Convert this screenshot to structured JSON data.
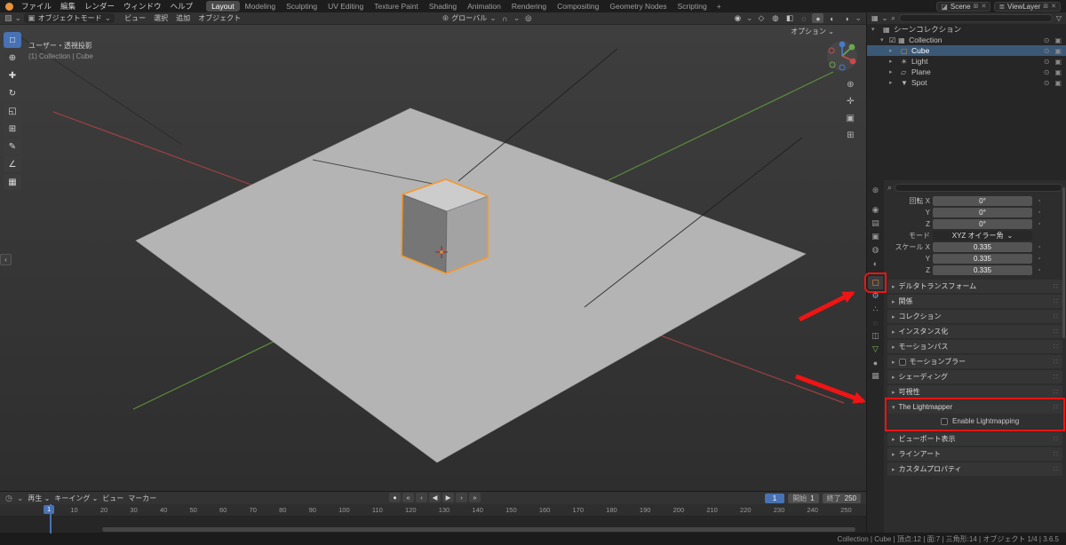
{
  "colors": {
    "accent_blue": "#4772b3",
    "selection_orange": "#e8923d",
    "annotation_red": "#f01414"
  },
  "icons": {
    "chevron_down": "⌄",
    "chevron_right": "▸",
    "chevron_open": "▾",
    "eye": "⊙",
    "camera_toggle": "▣",
    "search": "⌕",
    "drag_dots": "∷",
    "lock": "▫",
    "magnet": "∩",
    "proportional": "◎",
    "orientation_globe": "⊕",
    "shading_wire": "◌",
    "shading_solid": "●",
    "shading_material": "◐",
    "shading_rendered": "◑",
    "grid": "⊞",
    "pan": "✛",
    "zoom": "⊕",
    "view_camera": "▣",
    "plus": "+",
    "close": "✕",
    "funnel": "▽",
    "collection": "▦",
    "editor_viewport": "▧",
    "editor_timeline": "◷",
    "menu": "≡",
    "auto_key": "●",
    "object_mode": "▣",
    "overlays": "◍",
    "xray": "◧",
    "gizmo": "◇",
    "visibility": "◉",
    "scene": "◪",
    "viewlayer": "≣",
    "new": "⊞",
    "sidebar_arrow": "‹"
  },
  "topbar": {
    "menus": [
      "ファイル",
      "編集",
      "レンダー",
      "ウィンドウ",
      "ヘルプ"
    ],
    "workspaces": [
      {
        "label": "Layout",
        "cls": "active"
      },
      {
        "label": "Modeling"
      },
      {
        "label": "Sculpting"
      },
      {
        "label": "UV Editing"
      },
      {
        "label": "Texture Paint"
      },
      {
        "label": "Shading"
      },
      {
        "label": "Animation"
      },
      {
        "label": "Rendering"
      },
      {
        "label": "Compositing"
      },
      {
        "label": "Geometry Nodes"
      },
      {
        "label": "Scripting"
      }
    ],
    "add_workspace": "+",
    "scene_label": "Scene",
    "viewlayer_label": "ViewLayer"
  },
  "viewport": {
    "header": {
      "mode": "オブジェクトモード",
      "menus": [
        "ビュー",
        "選択",
        "追加",
        "オブジェクト"
      ],
      "orientation": "グローバル"
    },
    "options_label": "オプション",
    "overlay_line1": "ユーザー・透視投影",
    "overlay_line2": "(1) Collection | Cube",
    "tools": [
      {
        "name": "tool-select-box",
        "glyph": "□",
        "cls": "active"
      },
      {
        "name": "tool-cursor",
        "glyph": "⊕"
      },
      {
        "name": "tool-move",
        "glyph": "✚"
      },
      {
        "name": "tool-rotate",
        "glyph": "↻"
      },
      {
        "name": "tool-scale",
        "glyph": "◱"
      },
      {
        "name": "tool-transform",
        "glyph": "⊞"
      },
      {
        "name": "tool-annotate",
        "glyph": "✎"
      },
      {
        "name": "tool-measure",
        "glyph": "∠"
      },
      {
        "name": "tool-add-cube",
        "glyph": "▦"
      }
    ]
  },
  "outliner": {
    "rows": [
      {
        "name": "outliner-row-scene-collection",
        "chev": "▾",
        "glyph": "▦",
        "label": "シーンコレクション",
        "cls": "ind0 no-rt"
      },
      {
        "name": "outliner-row-collection",
        "chev": "▾",
        "glyph": "▦",
        "check": "☑",
        "label": "Collection",
        "cls": "ind1"
      },
      {
        "name": "outliner-row-cube",
        "chev": "▸",
        "glyph": "▢",
        "label": "Cube",
        "cls": "ind2 active glyph-orange"
      },
      {
        "name": "outliner-row-light",
        "chev": "▸",
        "glyph": "☀",
        "label": "Light",
        "cls": "ind2"
      },
      {
        "name": "outliner-row-plane",
        "chev": "▸",
        "glyph": "▱",
        "label": "Plane",
        "cls": "ind2"
      },
      {
        "name": "outliner-row-spot",
        "chev": "▸",
        "glyph": "▼",
        "label": "Spot",
        "cls": "ind2"
      }
    ]
  },
  "properties": {
    "tabs": [
      {
        "name": "tab-tool",
        "glyph": "⊛"
      },
      {
        "name": "tab-render",
        "glyph": "◉",
        "cls": "gap"
      },
      {
        "name": "tab-output",
        "glyph": "▤"
      },
      {
        "name": "tab-view-layer",
        "glyph": "▣"
      },
      {
        "name": "tab-scene",
        "glyph": "◍"
      },
      {
        "name": "tab-world",
        "glyph": "◐"
      },
      {
        "name": "tab-object",
        "glyph": "▢",
        "cls": "gap active red-target c-orange"
      },
      {
        "name": "tab-modifiers",
        "glyph": "⚙",
        "cls": "c-blue"
      },
      {
        "name": "tab-particles",
        "glyph": "∴",
        "cls": "c-blue"
      },
      {
        "name": "tab-physics",
        "glyph": "◌",
        "cls": "c-blue"
      },
      {
        "name": "tab-constraints",
        "glyph": "◫"
      },
      {
        "name": "tab-data",
        "glyph": "▽",
        "cls": "c-green"
      },
      {
        "name": "tab-material",
        "glyph": "●"
      },
      {
        "name": "tab-texture",
        "glyph": "▦"
      }
    ],
    "transform": {
      "rot_x_label": "回転 X",
      "rot_x": "0°",
      "rot_y_label": "Y",
      "rot_y": "0°",
      "rot_z_label": "Z",
      "rot_z": "0°",
      "mode_label": "モード",
      "mode_value": "XYZ オイラー角",
      "scale_x_label": "スケール X",
      "scale_x": "0.335",
      "scale_y_label": "Y",
      "scale_y": "0.335",
      "scale_z_label": "Z",
      "scale_z": "0.335"
    },
    "panels_top": [
      {
        "label": "デルタトランスフォーム"
      },
      {
        "label": "関係"
      },
      {
        "label": "コレクション"
      },
      {
        "label": "インスタンス化"
      },
      {
        "label": "モーションパス"
      },
      {
        "label": "モーションブラー",
        "cls": "with-check"
      },
      {
        "label": "シェーディング"
      },
      {
        "label": "可視性"
      }
    ],
    "lightmapper": {
      "title": "The Lightmapper",
      "option_label": "Enable Lightmapping"
    },
    "panels_bottom": [
      {
        "label": "ビューポート表示"
      },
      {
        "label": "ラインアート"
      },
      {
        "label": "カスタムプロパティ"
      }
    ]
  },
  "timeline": {
    "menu_playback": "再生",
    "menu_keying": "キーイング",
    "menu_view": "ビュー",
    "menu_marker": "マーカー",
    "buttons": [
      {
        "name": "auto-keying-button",
        "glyph": "●"
      },
      {
        "name": "jump-to-start-button",
        "glyph": "«"
      },
      {
        "name": "prev-keyframe-button",
        "glyph": "‹"
      },
      {
        "name": "play-reverse-button",
        "glyph": "◀"
      },
      {
        "name": "play-button",
        "glyph": "▶"
      },
      {
        "name": "next-keyframe-button",
        "glyph": "›"
      },
      {
        "name": "jump-to-end-button",
        "glyph": "»"
      }
    ],
    "current_frame": "1",
    "start_label": "開始",
    "start_value": "1",
    "end_label": "終了",
    "end_value": "250",
    "ticks": [
      "1",
      "10",
      "20",
      "30",
      "40",
      "50",
      "60",
      "70",
      "80",
      "90",
      "100",
      "110",
      "120",
      "130",
      "140",
      "150",
      "160",
      "170",
      "180",
      "190",
      "200",
      "210",
      "220",
      "230",
      "240",
      "250"
    ]
  },
  "statusbar": {
    "text": "Collection | Cube | 頂点:12 | 面:7 | 三角形:14 | オブジェクト 1/4 | 3.6.5"
  }
}
